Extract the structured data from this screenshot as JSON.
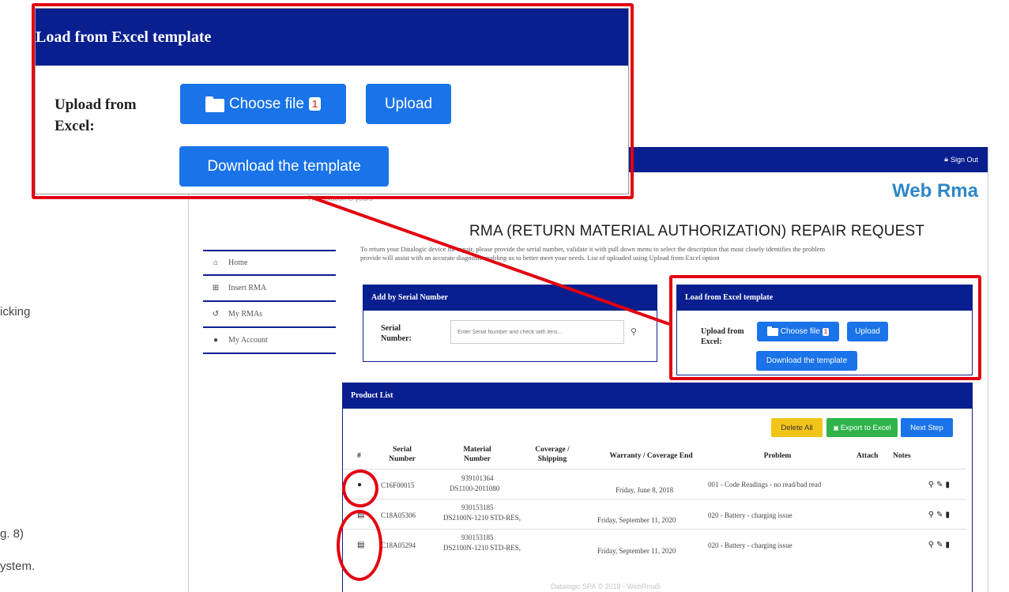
{
  "colors": {
    "navy": "#0a1f8f",
    "brand": "#2e87c7",
    "primary": "#1a73e8",
    "warning": "#f0c419",
    "success": "#2fb34a",
    "annotation": "#e3000f"
  },
  "doc_fragment": [
    "icking",
    "g. 8)",
    "ystem."
  ],
  "header": {
    "sign_out": "Sign Out",
    "brand": "Web Rma",
    "tagline": "The solution is yours"
  },
  "sidebar": {
    "items": [
      {
        "icon": "home-icon",
        "glyph": "⌂",
        "label": "Home"
      },
      {
        "icon": "plus-square-icon",
        "glyph": "⊞",
        "label": "Insert RMA"
      },
      {
        "icon": "history-icon",
        "glyph": "↺",
        "label": "My RMAs"
      },
      {
        "icon": "user-icon",
        "glyph": "●",
        "label": "My Account"
      }
    ]
  },
  "main": {
    "title": "RMA (RETURN MATERIAL AUTHORIZATION) REPAIR REQUEST",
    "intro_line1": "To return your Datalogic device for repair, please provide the serial number, validate it with pull down menu to select the description that most closely identifies the problem",
    "intro_line2": "provide will assist with an accurate diagnosis enabling us to better meet your needs. List of uploaded using Upload from Excel option"
  },
  "serial_panel": {
    "title": "Add by Serial Number",
    "label_line1": "Serial",
    "label_line2": "Number:",
    "placeholder": "Enter Serial Number and check with lens..."
  },
  "excel_panel": {
    "title": "Load from Excel template",
    "label_line1": "Upload from",
    "label_line2": "Excel:",
    "choose_file": "Choose file",
    "badge": "1",
    "upload": "Upload",
    "download": "Download the template"
  },
  "product_list": {
    "title": "Product List",
    "actions": {
      "delete_all": "Delete All",
      "export": "Export to Excel",
      "next": "Next Step"
    },
    "columns": {
      "index": "#",
      "serial_l1": "Serial",
      "serial_l2": "Number",
      "material_l1": "Material",
      "material_l2": "Number",
      "coverage_l1": "Coverage /",
      "coverage_l2": "Shipping",
      "warranty": "Warranty / Coverage End",
      "problem": "Problem",
      "attach": "Attach",
      "notes": "Notes"
    },
    "rows": [
      {
        "type_icon": "user-icon",
        "glyph": "●",
        "serial": "C16F00015",
        "material_1": "939101364",
        "material_2": "DS1100-2011080",
        "warranty": "Friday, June 8, 2018",
        "problem": "001 - Code Readings - no read/bad read"
      },
      {
        "type_icon": "file-icon",
        "glyph": "▤",
        "serial": "C18A05306",
        "material_1": "930153185",
        "material_2": "DS2100N-1210 STD-RES,",
        "warranty": "Friday, September 11, 2020",
        "problem": "020 - Battery - charging issue"
      },
      {
        "type_icon": "file-icon",
        "glyph": "▤",
        "serial": "C18A05294",
        "material_1": "930153185",
        "material_2": "DS2100N-1210 STD-RES,",
        "warranty": "Friday, September 11, 2020",
        "problem": "020 - Battery - charging issue"
      }
    ],
    "row_actions": {
      "attach_icon": "paperclip-icon",
      "edit_icon": "edit-icon",
      "delete_icon": "trash-icon"
    }
  },
  "footer": "Datalogic SPA © 2018 - WebRma5",
  "zoom_callout": {
    "title": "Load from Excel template",
    "label_line1": "Upload from",
    "label_line2": "Excel:",
    "choose_file": "Choose file",
    "badge": "1",
    "upload": "Upload",
    "download": "Download the template"
  }
}
